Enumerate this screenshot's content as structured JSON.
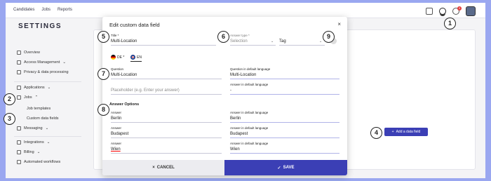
{
  "topnav": {
    "items": [
      "Candidates",
      "Jobs",
      "Reports"
    ]
  },
  "topbar": {
    "notification_count": "3"
  },
  "sidebar": {
    "title": "SETTINGS",
    "items": [
      {
        "label": "Overview",
        "icon": "home-icon"
      },
      {
        "label": "Access Management",
        "icon": "key-icon",
        "chevron": "⌄"
      },
      {
        "label": "Privacy & data processing",
        "icon": "lock-icon"
      },
      {
        "label": "Applications",
        "icon": "folder-icon",
        "chevron": "⌄"
      },
      {
        "label": "Jobs",
        "icon": "briefcase-icon",
        "chevron": "⌃"
      },
      {
        "label": "Messaging",
        "icon": "mail-icon",
        "chevron": "⌄"
      },
      {
        "label": "Integrations",
        "icon": "plug-icon",
        "chevron": "⌄"
      },
      {
        "label": "Billing",
        "icon": "card-icon",
        "chevron": "⌄"
      },
      {
        "label": "Automated workflows",
        "icon": "workflow-icon"
      }
    ],
    "subitems": [
      "Job templates",
      "Custom data fields"
    ]
  },
  "add_field_label": "Add a data field",
  "markers": [
    "1",
    "2",
    "3",
    "4",
    "5",
    "6",
    "7",
    "8",
    "9"
  ],
  "modal": {
    "title": "Edit custom data field",
    "close": "×",
    "title_label": "Title *",
    "title_value": "Multi-Location",
    "answer_type_label": "Answer type *",
    "answer_type_placeholder": "Selection",
    "tag_value": "Tag",
    "lang_tabs": [
      {
        "label": "DE *"
      },
      {
        "label": "EN"
      }
    ],
    "question_label": "Question",
    "question_value": "Multi-Location",
    "question_default_label": "Question in default language",
    "question_default_value": "Multi-Location",
    "placeholder_input": "Placeholder (e.g. Enter your answer)",
    "answer_default_label": "Answer in default language",
    "answer_default_value": "-",
    "answer_options_title": "Answer Options",
    "answers": [
      {
        "label": "Answer",
        "value": "Berlin",
        "default_label": "Answer in default language",
        "default_value": "Berlin"
      },
      {
        "label": "Answer",
        "value": "Budapest",
        "default_label": "Answer in default language",
        "default_value": "Budapest"
      },
      {
        "label": "Answer",
        "value": "Wien",
        "default_label": "Answer in default language",
        "default_value": "Wien"
      }
    ],
    "cancel_label": "CANCEL",
    "save_label": "SAVE"
  },
  "colors": {
    "accent": "#3b3fb5",
    "backdrop": "#9aa7f0"
  }
}
